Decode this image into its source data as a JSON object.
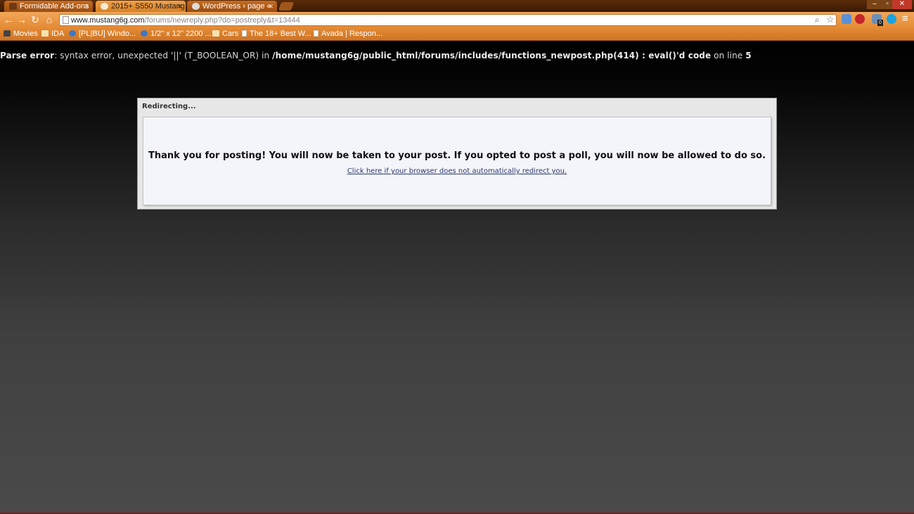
{
  "browser": {
    "tabs": [
      {
        "title": "Formidable Add-ons",
        "active": false
      },
      {
        "title": "2015+ S550 Mustang",
        "active": true
      },
      {
        "title": "WordPress › page «",
        "active": false
      }
    ],
    "url": {
      "host": "www.mustang6g.com",
      "path": "/forums/newreply.php?do=postreply&t=13444"
    },
    "extension_badge": "0",
    "bookmarks": [
      "Movies",
      "IDA",
      "[PL|BU] Windo...",
      "1/2\" x 12\" 2200 ...",
      "Cars",
      "The 18+ Best W...",
      "Avada | Respon..."
    ]
  },
  "page": {
    "error": {
      "label": "Parse error",
      "message": ": syntax error, unexpected '||' (T_BOOLEAN_OR) in ",
      "path": "/home/mustang6g/public_html/forums/includes/functions_newpost.php(414) : eval()'d code",
      "line_text": " on line ",
      "line": "5"
    },
    "redirect": {
      "title": "Redirecting...",
      "message": "Thank you for posting! You will now be taken to your post. If you opted to post a poll, you will now be allowed to do so.",
      "link": "Click here if your browser does not automatically redirect you."
    }
  },
  "colors": {
    "chrome_accent": "#e48a34",
    "link": "#2c3a6e"
  }
}
